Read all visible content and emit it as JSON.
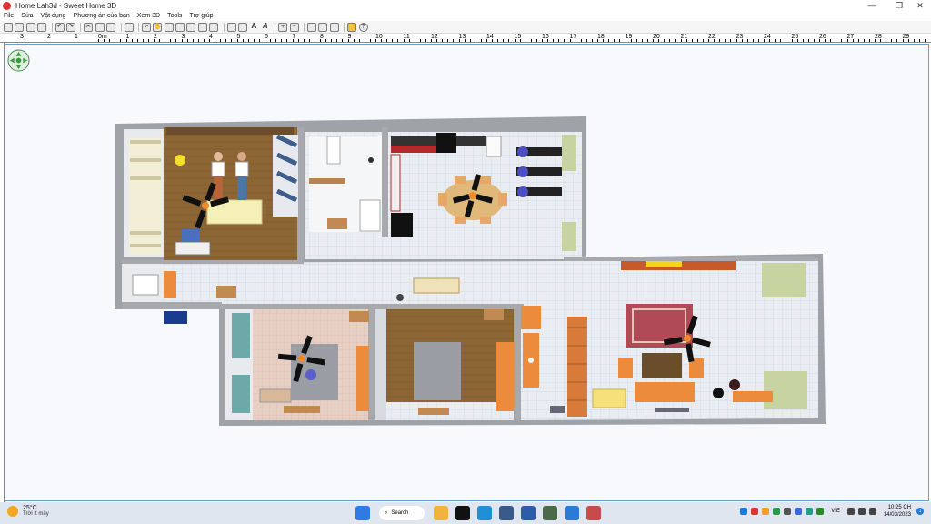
{
  "window": {
    "title": "Home Lah3d - Sweet Home 3D",
    "minimize": "—",
    "maximize": "❐",
    "close": "✕"
  },
  "menu": {
    "items": [
      "File",
      "Sửa",
      "Vật dụng",
      "Phương án của bạn",
      "Xem 3D",
      "Tools",
      "Trợ giúp"
    ]
  },
  "toolbar": {
    "icons": [
      "new-file-icon",
      "open-icon",
      "save-icon",
      "cut-like-icon",
      "undo-icon",
      "redo-icon",
      "cut-icon",
      "copy-icon",
      "paste-icon",
      "paste-style-icon",
      "select-icon",
      "pan-icon",
      "create-walls-icon",
      "create-rooms-icon",
      "create-polylines-icon",
      "create-dimensions-icon",
      "create-labels-icon",
      "text-icon",
      "zoom-in-icon",
      "zoom-out-icon",
      "import-furniture-icon",
      "create-photo-icon",
      "help-icon"
    ],
    "text_a": "A",
    "text_a_italic": "A"
  },
  "ruler": {
    "labels": [
      "0m",
      "1",
      "2",
      "3",
      "4",
      "5",
      "6",
      "7",
      "8",
      "9",
      "10",
      "11",
      "12",
      "13",
      "14",
      "15",
      "16",
      "17",
      "18",
      "19",
      "20",
      "21",
      "22",
      "23",
      "24",
      "25",
      "26",
      "27",
      "28",
      "29"
    ],
    "left_labels": [
      "3",
      "2",
      "1"
    ]
  },
  "taskbar": {
    "temperature": "25°C",
    "condition": "Trời ít mây",
    "search_label": "Search",
    "language": "VIE",
    "time": "10:25 CH",
    "date": "14/03/2023",
    "notification_count": "1"
  },
  "colors": {
    "canvas_bg": "#f7f9fc",
    "floor_tile": "#e8ecf1",
    "wood_floor": "#8a6a3a",
    "wall": "#a7a9ac",
    "accent_orange": "#ec8b3c"
  }
}
